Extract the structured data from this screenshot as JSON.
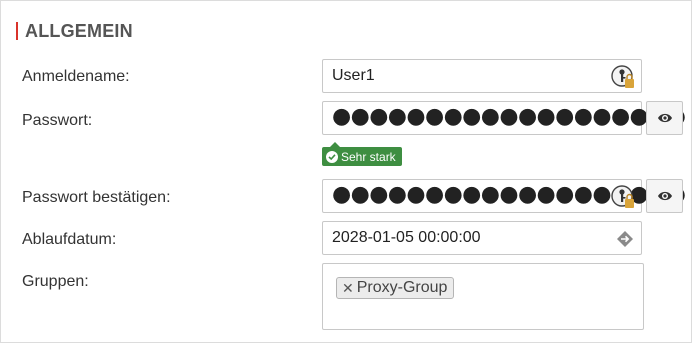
{
  "section": {
    "title": "ALLGEMEIN"
  },
  "fields": {
    "username": {
      "label": "Anmeldename:",
      "value": "User1"
    },
    "password": {
      "label": "Passwort:",
      "value": "●●●●●●●●●●●●●●●●●●●"
    },
    "password_strength": "Sehr stark",
    "password_confirm": {
      "label": "Passwort bestätigen:",
      "value": "●●●●●●●●●●●●●●●●●●●"
    },
    "expiry": {
      "label": "Ablaufdatum:",
      "value": "2028-01-05 00:00:00"
    },
    "groups": {
      "label": "Gruppen:",
      "items": [
        "Proxy-Group"
      ]
    }
  },
  "icons": {
    "key_generator": "key-lock-icon",
    "show_password": "eye-icon",
    "date_picker": "calendar-arrow-icon",
    "remove_chip": "close-icon",
    "strength_ok": "check-icon"
  },
  "colors": {
    "accent": "#d9332b",
    "strength_badge": "#3e8e41",
    "lock": "#d9a43a"
  }
}
